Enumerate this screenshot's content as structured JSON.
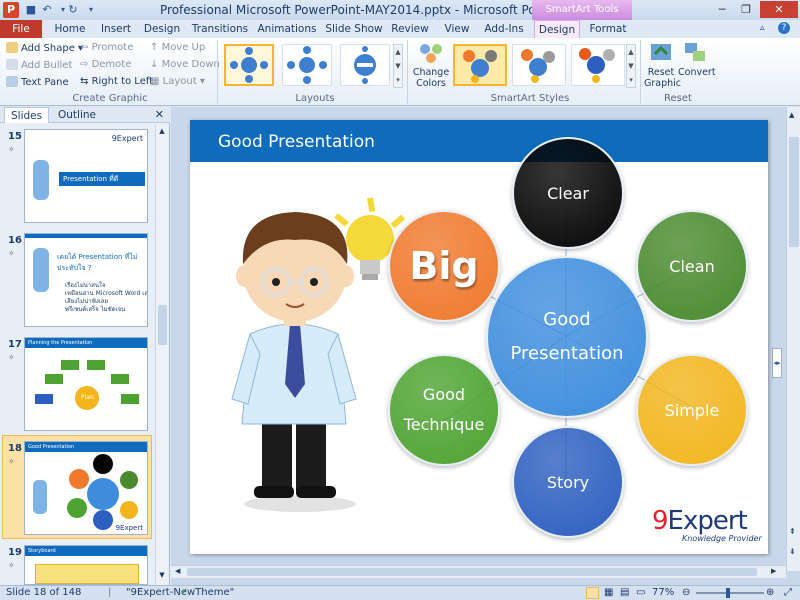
{
  "window": {
    "title": "Professional Microsoft PowerPoint-MAY2014.pptx - Microsoft PowerPoint",
    "contextual_tab_group": "SmartArt Tools",
    "app_icon": "P"
  },
  "tabs": [
    "File",
    "Home",
    "Insert",
    "Design",
    "Transitions",
    "Animations",
    "Slide Show",
    "Review",
    "View",
    "Add-Ins",
    "Design",
    "Format"
  ],
  "ribbon": {
    "create_graphic": {
      "items": [
        "Add Shape",
        "Add Bullet",
        "Text Pane",
        "Promote",
        "Demote",
        "Right to Left",
        "Move Up",
        "Move Down",
        "Layout"
      ],
      "label": "Create Graphic"
    },
    "layouts": {
      "label": "Layouts"
    },
    "smartart_styles": {
      "change_colors": "Change Colors",
      "label": "SmartArt Styles"
    },
    "reset": {
      "reset_graphic": "Reset Graphic",
      "convert": "Convert",
      "label": "Reset"
    }
  },
  "left_pane": {
    "tabs": [
      "Slides",
      "Outline"
    ],
    "slides": [
      {
        "number": "15",
        "title": "Presentation ที่ดี",
        "brand": "9Expert"
      },
      {
        "number": "16",
        "title": "เคยได้ Presentation ที่ไม่ประทับใจ ?",
        "bullets": [
          "เรื่องไม่น่าสนใจ",
          "เหมือนอ่าน Microsoft Word เล่ม",
          "เสียงไม่น่าฟังเลย",
          "พรีเซนต์เสร็จ ไม่ชัดเจน"
        ]
      },
      {
        "number": "17",
        "title": "Planning the Presentation",
        "center": "Plan"
      },
      {
        "number": "18",
        "title": "Good Presentation",
        "center": "Good Presentation",
        "brand": "9Expert"
      },
      {
        "number": "19",
        "title": "Storyboard"
      }
    ],
    "selected": "18"
  },
  "slide": {
    "title": "Good Presentation",
    "center": "Good Presentation",
    "nodes": [
      {
        "label": "Big",
        "color": "#f0782c"
      },
      {
        "label": "Clear",
        "color": "#050505"
      },
      {
        "label": "Clean",
        "color": "#4a8a2e"
      },
      {
        "label": "Simple",
        "color": "#f2b51c"
      },
      {
        "label": "Story",
        "color": "#2d5fc0"
      },
      {
        "label": "Good Technique",
        "color": "#4da331"
      }
    ],
    "center_color": "#3e8ddd",
    "brand": {
      "name_prefix": "9",
      "name": "Expert",
      "subtitle": "Knowledge Provider"
    }
  },
  "status": {
    "slide_info": "Slide 18 of 148",
    "theme": "\"9Expert-NewTheme\"",
    "zoom": "77%"
  }
}
